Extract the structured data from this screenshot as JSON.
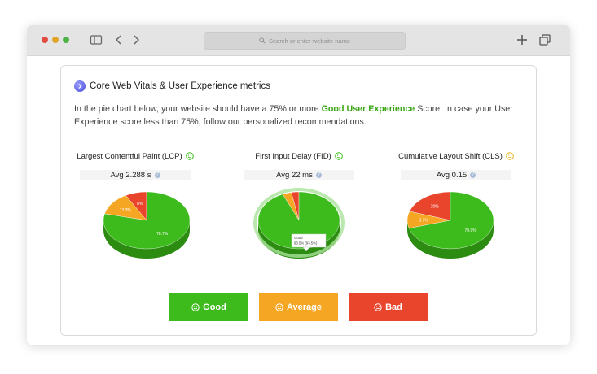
{
  "browser": {
    "address_placeholder": "Search or enter website name"
  },
  "section": {
    "title": "Core Web Vitals & User Experience metrics",
    "intro_before": "In the pie chart below, your website should have a 75% or more ",
    "intro_highlight": "Good User Experience",
    "intro_after": " Score. In case your User Experience score less than 75%, follow our personalized recommendations."
  },
  "metrics": [
    {
      "title": "Largest Contentful Paint (LCP)",
      "avg": "Avg 2.288 s",
      "status": "good"
    },
    {
      "title": "First Input Delay (FID)",
      "avg": "Avg 22 ms",
      "status": "good"
    },
    {
      "title": "Cumulative Layout Shift (CLS)",
      "avg": "Avg 0.15",
      "status": "average"
    }
  ],
  "chart_data": [
    {
      "type": "pie",
      "title": "Largest Contentful Paint (LCP)",
      "categories": [
        "Good",
        "Average",
        "Bad"
      ],
      "values": [
        78.7,
        13.3,
        8
      ],
      "labels": [
        "78.7%",
        "13.3%",
        "8%"
      ]
    },
    {
      "type": "pie",
      "title": "First Input Delay (FID)",
      "categories": [
        "Good",
        "Average",
        "Bad"
      ],
      "values": [
        93.5,
        3.5,
        3
      ],
      "labels": [
        "",
        "",
        ""
      ],
      "tooltip": {
        "title": "Good",
        "text": "93.5% (93.5%)"
      }
    },
    {
      "type": "pie",
      "title": "Cumulative Layout Shift (CLS)",
      "categories": [
        "Good",
        "Average",
        "Bad"
      ],
      "values": [
        70.9,
        9.7,
        20
      ],
      "labels": [
        "70.9%",
        "9.7%",
        "20%"
      ]
    }
  ],
  "legend": {
    "good": "Good",
    "average": "Average",
    "bad": "Bad"
  },
  "colors": {
    "good": "#3dbb1c",
    "average": "#f5a623",
    "bad": "#e8452c",
    "good_shadow": "#2c8c12",
    "average_shadow": "#c98417",
    "bad_shadow": "#b8331f",
    "highlight": "#3aa616",
    "face_good": "#3dbb1c",
    "face_average": "#e9b321"
  }
}
